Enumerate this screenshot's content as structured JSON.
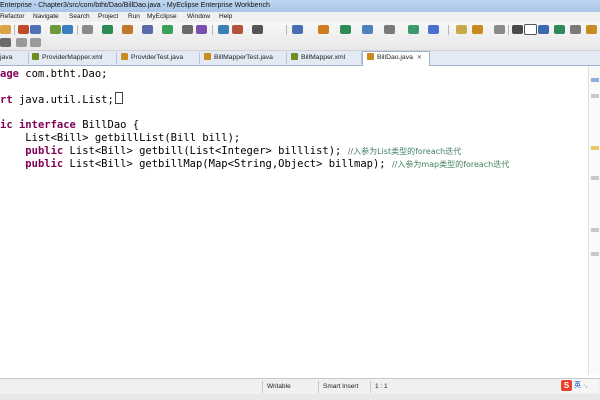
{
  "window": {
    "title": "Enterprise - Chapter3/src/com/btht/Dao/BillDao.java - MyEclipse Enterprise Workbench"
  },
  "menu": {
    "items": [
      "Refactor",
      "Navigate",
      "Search",
      "Project",
      "Run",
      "MyEclipse",
      "Window",
      "Help"
    ]
  },
  "tabs": [
    {
      "label": "java",
      "icon": "java-file-icon",
      "color": "#c98a1f"
    },
    {
      "label": "ProviderMapper.xml",
      "icon": "xml-file-icon",
      "color": "#6b8e23"
    },
    {
      "label": "ProviderTest.java",
      "icon": "java-file-icon",
      "color": "#c98a1f"
    },
    {
      "label": "BillMapperTest.java",
      "icon": "java-file-icon",
      "color": "#c98a1f"
    },
    {
      "label": "BillMapper.xml",
      "icon": "xml-file-icon",
      "color": "#6b8e23"
    },
    {
      "label": "BillDao.java",
      "icon": "java-file-icon",
      "color": "#c98a1f",
      "active": true,
      "close": "✕"
    }
  ],
  "code": {
    "l1_kw": "age",
    "l1_rest": " com.btht.Dao;",
    "l2_kw": "rt",
    "l2_rest": " java.util.List;",
    "l3_kw1": "ic",
    "l3_kw2": "interface",
    "l3_rest": " BillDao {",
    "l4": "    List<Bill> getbillList(Bill bill);",
    "l5_kw": "public",
    "l5_rest": " List<Bill> getbill(List<Integer> billlist); ",
    "l5_cm": "//入参为List类型的foreach迭代",
    "l6_kw": "public",
    "l6_rest": " List<Bill> getbillMap(Map<String,Object> billmap); ",
    "l6_cm": "//入参为map类型的foreach迭代"
  },
  "status": {
    "writable": "Writable",
    "insert_mode": "Smart Insert",
    "position": "1 : 1"
  },
  "ime": {
    "logo": "S",
    "lang": "英 ·,"
  },
  "colors": {
    "keyword": "#7f0055",
    "comment": "#3f7f5f",
    "title_bar": "#bfd6ef"
  }
}
